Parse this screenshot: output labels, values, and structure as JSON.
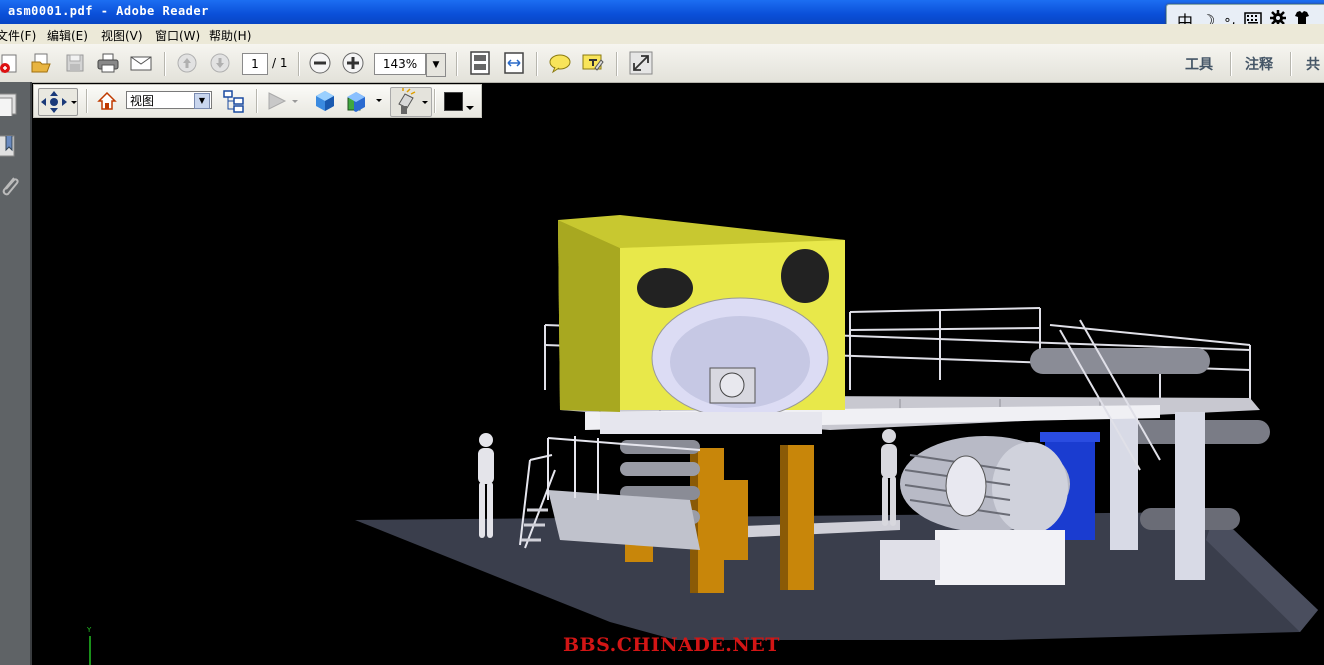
{
  "window": {
    "title": "asm0001.pdf - Adobe Reader"
  },
  "ime": {
    "glyph1": "中",
    "glyph2": "☽",
    "glyph3": "∘,"
  },
  "menu": {
    "file": "文件(F)",
    "edit": "编辑(E)",
    "view": "视图(V)",
    "window": "窗口(W)",
    "help": "帮助(H)"
  },
  "toolbar": {
    "page_current": "1",
    "page_total": "/ 1",
    "zoom": "143%",
    "tools": "工具",
    "comment": "注释",
    "share": "共"
  },
  "toolbar3d": {
    "view_select": "视图",
    "color_swatch": "#000000"
  },
  "axis": {
    "label": "Y"
  },
  "watermark": "BBS.CHINADE.NET",
  "colors": {
    "titlebar": "#0a4fd8",
    "yellow_housing": "#e8e84a",
    "orange_column": "#c8860a",
    "floor": "#3a3e4c"
  }
}
